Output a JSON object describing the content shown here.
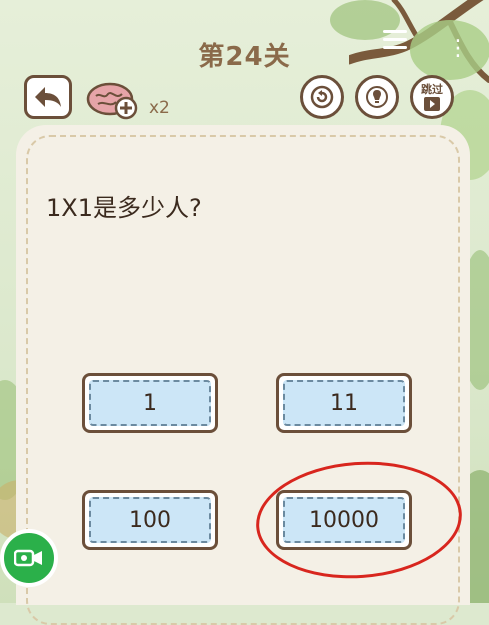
{
  "level": {
    "title": "第24关"
  },
  "toolbar": {
    "hint_count": "x2",
    "skip_label": "跳过"
  },
  "question": {
    "text": "1X1是多少人?"
  },
  "answers": [
    {
      "label": "1"
    },
    {
      "label": "11"
    },
    {
      "label": "100"
    },
    {
      "label": "10000"
    }
  ],
  "icons": {
    "menu": "menu-icon",
    "more": "more-icon",
    "back": "back-arrow-icon",
    "brain": "brain-plus-icon",
    "restart": "restart-icon",
    "hint": "lightbulb-icon",
    "skip": "skip-video-icon",
    "video": "video-camera-icon"
  },
  "colors": {
    "accent_brown": "#6b4f3a",
    "answer_fill": "#cce6f7",
    "highlight": "#d8261e",
    "video_green": "#2bb04a"
  }
}
